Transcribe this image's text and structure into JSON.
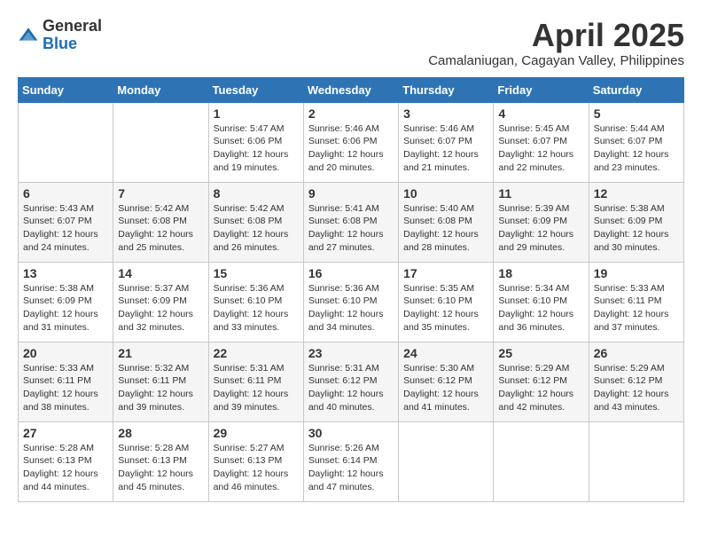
{
  "header": {
    "logo_general": "General",
    "logo_blue": "Blue",
    "month_title": "April 2025",
    "location": "Camalaniugan, Cagayan Valley, Philippines"
  },
  "days_of_week": [
    "Sunday",
    "Monday",
    "Tuesday",
    "Wednesday",
    "Thursday",
    "Friday",
    "Saturday"
  ],
  "weeks": [
    [
      {
        "day": "",
        "info": ""
      },
      {
        "day": "",
        "info": ""
      },
      {
        "day": "1",
        "info": "Sunrise: 5:47 AM\nSunset: 6:06 PM\nDaylight: 12 hours and 19 minutes."
      },
      {
        "day": "2",
        "info": "Sunrise: 5:46 AM\nSunset: 6:06 PM\nDaylight: 12 hours and 20 minutes."
      },
      {
        "day": "3",
        "info": "Sunrise: 5:46 AM\nSunset: 6:07 PM\nDaylight: 12 hours and 21 minutes."
      },
      {
        "day": "4",
        "info": "Sunrise: 5:45 AM\nSunset: 6:07 PM\nDaylight: 12 hours and 22 minutes."
      },
      {
        "day": "5",
        "info": "Sunrise: 5:44 AM\nSunset: 6:07 PM\nDaylight: 12 hours and 23 minutes."
      }
    ],
    [
      {
        "day": "6",
        "info": "Sunrise: 5:43 AM\nSunset: 6:07 PM\nDaylight: 12 hours and 24 minutes."
      },
      {
        "day": "7",
        "info": "Sunrise: 5:42 AM\nSunset: 6:08 PM\nDaylight: 12 hours and 25 minutes."
      },
      {
        "day": "8",
        "info": "Sunrise: 5:42 AM\nSunset: 6:08 PM\nDaylight: 12 hours and 26 minutes."
      },
      {
        "day": "9",
        "info": "Sunrise: 5:41 AM\nSunset: 6:08 PM\nDaylight: 12 hours and 27 minutes."
      },
      {
        "day": "10",
        "info": "Sunrise: 5:40 AM\nSunset: 6:08 PM\nDaylight: 12 hours and 28 minutes."
      },
      {
        "day": "11",
        "info": "Sunrise: 5:39 AM\nSunset: 6:09 PM\nDaylight: 12 hours and 29 minutes."
      },
      {
        "day": "12",
        "info": "Sunrise: 5:38 AM\nSunset: 6:09 PM\nDaylight: 12 hours and 30 minutes."
      }
    ],
    [
      {
        "day": "13",
        "info": "Sunrise: 5:38 AM\nSunset: 6:09 PM\nDaylight: 12 hours and 31 minutes."
      },
      {
        "day": "14",
        "info": "Sunrise: 5:37 AM\nSunset: 6:09 PM\nDaylight: 12 hours and 32 minutes."
      },
      {
        "day": "15",
        "info": "Sunrise: 5:36 AM\nSunset: 6:10 PM\nDaylight: 12 hours and 33 minutes."
      },
      {
        "day": "16",
        "info": "Sunrise: 5:36 AM\nSunset: 6:10 PM\nDaylight: 12 hours and 34 minutes."
      },
      {
        "day": "17",
        "info": "Sunrise: 5:35 AM\nSunset: 6:10 PM\nDaylight: 12 hours and 35 minutes."
      },
      {
        "day": "18",
        "info": "Sunrise: 5:34 AM\nSunset: 6:10 PM\nDaylight: 12 hours and 36 minutes."
      },
      {
        "day": "19",
        "info": "Sunrise: 5:33 AM\nSunset: 6:11 PM\nDaylight: 12 hours and 37 minutes."
      }
    ],
    [
      {
        "day": "20",
        "info": "Sunrise: 5:33 AM\nSunset: 6:11 PM\nDaylight: 12 hours and 38 minutes."
      },
      {
        "day": "21",
        "info": "Sunrise: 5:32 AM\nSunset: 6:11 PM\nDaylight: 12 hours and 39 minutes."
      },
      {
        "day": "22",
        "info": "Sunrise: 5:31 AM\nSunset: 6:11 PM\nDaylight: 12 hours and 39 minutes."
      },
      {
        "day": "23",
        "info": "Sunrise: 5:31 AM\nSunset: 6:12 PM\nDaylight: 12 hours and 40 minutes."
      },
      {
        "day": "24",
        "info": "Sunrise: 5:30 AM\nSunset: 6:12 PM\nDaylight: 12 hours and 41 minutes."
      },
      {
        "day": "25",
        "info": "Sunrise: 5:29 AM\nSunset: 6:12 PM\nDaylight: 12 hours and 42 minutes."
      },
      {
        "day": "26",
        "info": "Sunrise: 5:29 AM\nSunset: 6:12 PM\nDaylight: 12 hours and 43 minutes."
      }
    ],
    [
      {
        "day": "27",
        "info": "Sunrise: 5:28 AM\nSunset: 6:13 PM\nDaylight: 12 hours and 44 minutes."
      },
      {
        "day": "28",
        "info": "Sunrise: 5:28 AM\nSunset: 6:13 PM\nDaylight: 12 hours and 45 minutes."
      },
      {
        "day": "29",
        "info": "Sunrise: 5:27 AM\nSunset: 6:13 PM\nDaylight: 12 hours and 46 minutes."
      },
      {
        "day": "30",
        "info": "Sunrise: 5:26 AM\nSunset: 6:14 PM\nDaylight: 12 hours and 47 minutes."
      },
      {
        "day": "",
        "info": ""
      },
      {
        "day": "",
        "info": ""
      },
      {
        "day": "",
        "info": ""
      }
    ]
  ]
}
